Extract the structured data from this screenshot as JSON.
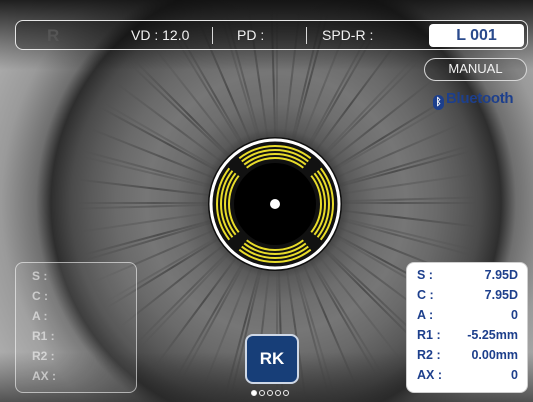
{
  "top_bar": {
    "eye_side": "R",
    "vd": "VD : 12.0",
    "pd": "PD :",
    "spd": "SPD-R :",
    "lens_id": "L 001"
  },
  "mode_button": "MANUAL",
  "bluetooth": {
    "label": "Bluetooth",
    "icon": "bluetooth-icon"
  },
  "left_panel": {
    "rows": [
      "S :",
      "C :",
      "A :",
      "R1 :",
      "R2 :",
      "AX :"
    ]
  },
  "right_panel": {
    "rows": [
      {
        "label": "S :",
        "value": "7.95D"
      },
      {
        "label": "C :",
        "value": "7.95D"
      },
      {
        "label": "A :",
        "value": "0"
      },
      {
        "label": "R1 :",
        "value": "-5.25mm"
      },
      {
        "label": "R2 :",
        "value": "0.00mm"
      },
      {
        "label": "AX :",
        "value": "0"
      }
    ]
  },
  "rk_button": "RK",
  "page_indicator": {
    "pages": 5,
    "current": 1
  },
  "colors": {
    "accent_blue": "#1d3f8c",
    "rk_button": "#173e78",
    "ring_yellow": "#e8dc2a"
  }
}
